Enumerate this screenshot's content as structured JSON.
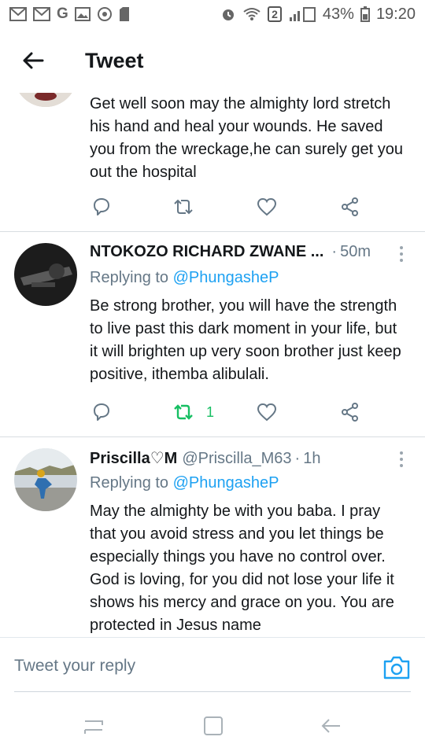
{
  "status_bar": {
    "left_icons": [
      "mail-icon",
      "mail-icon",
      "google-icon",
      "image-icon",
      "camera-icon",
      "sd-card-icon"
    ],
    "sim_badge": "2",
    "battery": "43%",
    "time": "19:20"
  },
  "header": {
    "title": "Tweet"
  },
  "tweets": [
    {
      "text": "Get well soon may the almighty lord stretch his hand and heal your wounds. He saved you from the wreckage,he can surely get you out the hospital",
      "retweet_count": ""
    },
    {
      "name": "NTOKOZO RICHARD ZWANE ...",
      "time": "50m",
      "replying_label": "Replying to",
      "replying_to": "@PhungasheP",
      "text": "Be strong brother, you will have the strength to live past this dark moment in your life, but it will brighten up very soon brother just keep positive, ithemba alibulali.",
      "retweet_count": "1",
      "retweet_active_color": "#17bf63"
    },
    {
      "name": "Priscilla♡M",
      "handle": "@Priscilla_M63",
      "time": "1h",
      "replying_label": "Replying to",
      "replying_to": "@PhungasheP",
      "text": "May the almighty be with you baba. I pray that you avoid stress and you let things be especially things you have no control over. God is loving, for you did not lose your life it shows his mercy and grace on you. You are protected in Jesus name"
    }
  ],
  "reply_bar": {
    "placeholder": "Tweet your reply"
  },
  "colors": {
    "accent": "#1da1f2",
    "retweet_green": "#17bf63",
    "muted": "#657786",
    "icon": "#657786"
  }
}
